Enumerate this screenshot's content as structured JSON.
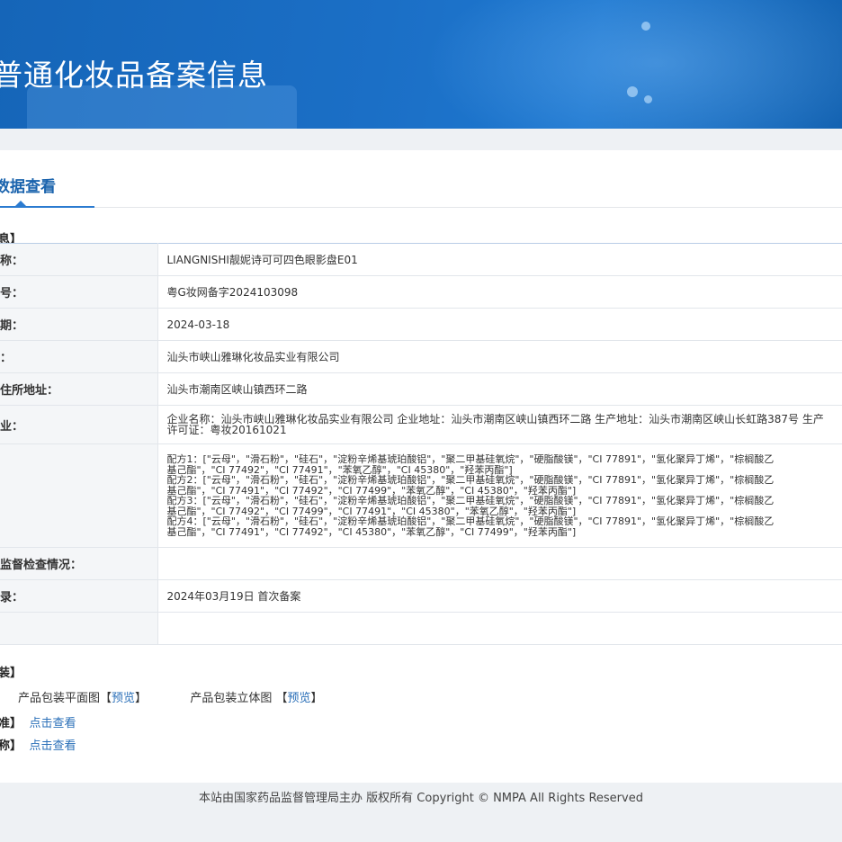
{
  "banner": {
    "title": "普通化妆品备案信息"
  },
  "tab": {
    "label": "数据查看"
  },
  "basic_info": {
    "heading": "息】",
    "rows": [
      {
        "key": "称：",
        "value": "LIANGNISHI靓妮诗可可四色眼影盘E01"
      },
      {
        "key": "号：",
        "value": "粤G妆网备字2024103098"
      },
      {
        "key": "期：",
        "value": "2024-03-18"
      },
      {
        "key": "：",
        "value": "汕头市峡山雅琳化妆品实业有限公司"
      },
      {
        "key": "住所地址：",
        "value": "汕头市潮南区峡山镇西环二路"
      },
      {
        "key": "业：",
        "value": "企业名称：汕头市峡山雅琳化妆品实业有限公司 企业地址：汕头市潮南区峡山镇西环二路 生产地址：汕头市潮南区峡山长虹路387号 生产许可证：粤妆20161021"
      },
      {
        "key": "",
        "formula": [
          "配方1：[\"云母\"，\"滑石粉\"，\"硅石\"，\"淀粉辛烯基琥珀酸铝\"，\"聚二甲基硅氧烷\"，\"硬脂酸镁\"，\"CI 77891\"，\"氢化聚异丁烯\"，\"棕榈酸乙",
          "基己酯\"，\"CI 77492\"，\"CI 77491\"，\"苯氧乙醇\"，\"CI 45380\"，\"羟苯丙酯\"]",
          "配方2：[\"云母\"，\"滑石粉\"，\"硅石\"，\"淀粉辛烯基琥珀酸铝\"，\"聚二甲基硅氧烷\"，\"硬脂酸镁\"，\"CI 77891\"，\"氢化聚异丁烯\"，\"棕榈酸乙",
          "基己酯\"，\"CI 77491\"，\"CI 77492\"，\"CI 77499\"，\"苯氧乙醇\"，\"CI 45380\"，\"羟苯丙酯\"]",
          "配方3：[\"云母\"，\"滑石粉\"，\"硅石\"，\"淀粉辛烯基琥珀酸铝\"，\"聚二甲基硅氧烷\"，\"硬脂酸镁\"，\"CI 77891\"，\"氢化聚异丁烯\"，\"棕榈酸乙",
          "基己酯\"，\"CI 77492\"，\"CI 77499\"，\"CI 77491\"，\"CI 45380\"，\"苯氧乙醇\"，\"羟苯丙酯\"]",
          "配方4：[\"云母\"，\"滑石粉\"，\"硅石\"，\"淀粉辛烯基琥珀酸铝\"，\"聚二甲基硅氧烷\"，\"硬脂酸镁\"，\"CI 77891\"，\"氢化聚异丁烯\"，\"棕榈酸乙",
          "基己酯\"，\"CI 77491\"，\"CI 77492\"，\"CI 45380\"，\"苯氧乙醇\"，\"CI 77499\"，\"羟苯丙酯\"]"
        ]
      },
      {
        "key": "监督检查情况：",
        "value": ""
      },
      {
        "key": "录：",
        "value": "2024年03月19日 首次备案"
      },
      {
        "key": "",
        "value": ""
      }
    ]
  },
  "packaging": {
    "heading": "装】",
    "flat_label": "产品包装平面图",
    "flat_link": "预览",
    "solid_label": "产品包装立体图",
    "solid_link": "预览",
    "open_bracket": "【",
    "close_bracket": "】",
    "open_bracket_sp": " 【"
  },
  "standard": {
    "heading": "准】",
    "link": "点击查看"
  },
  "name_explain": {
    "heading": "称】",
    "link": "点击查看"
  },
  "footer": {
    "text": "本站由国家药品监督管理局主办 版权所有 Copyright © NMPA All Rights Reserved"
  },
  "colors": {
    "banner": "#1b6fc6",
    "tab_accent": "#2b7bd0",
    "link": "#2a6fb8"
  }
}
